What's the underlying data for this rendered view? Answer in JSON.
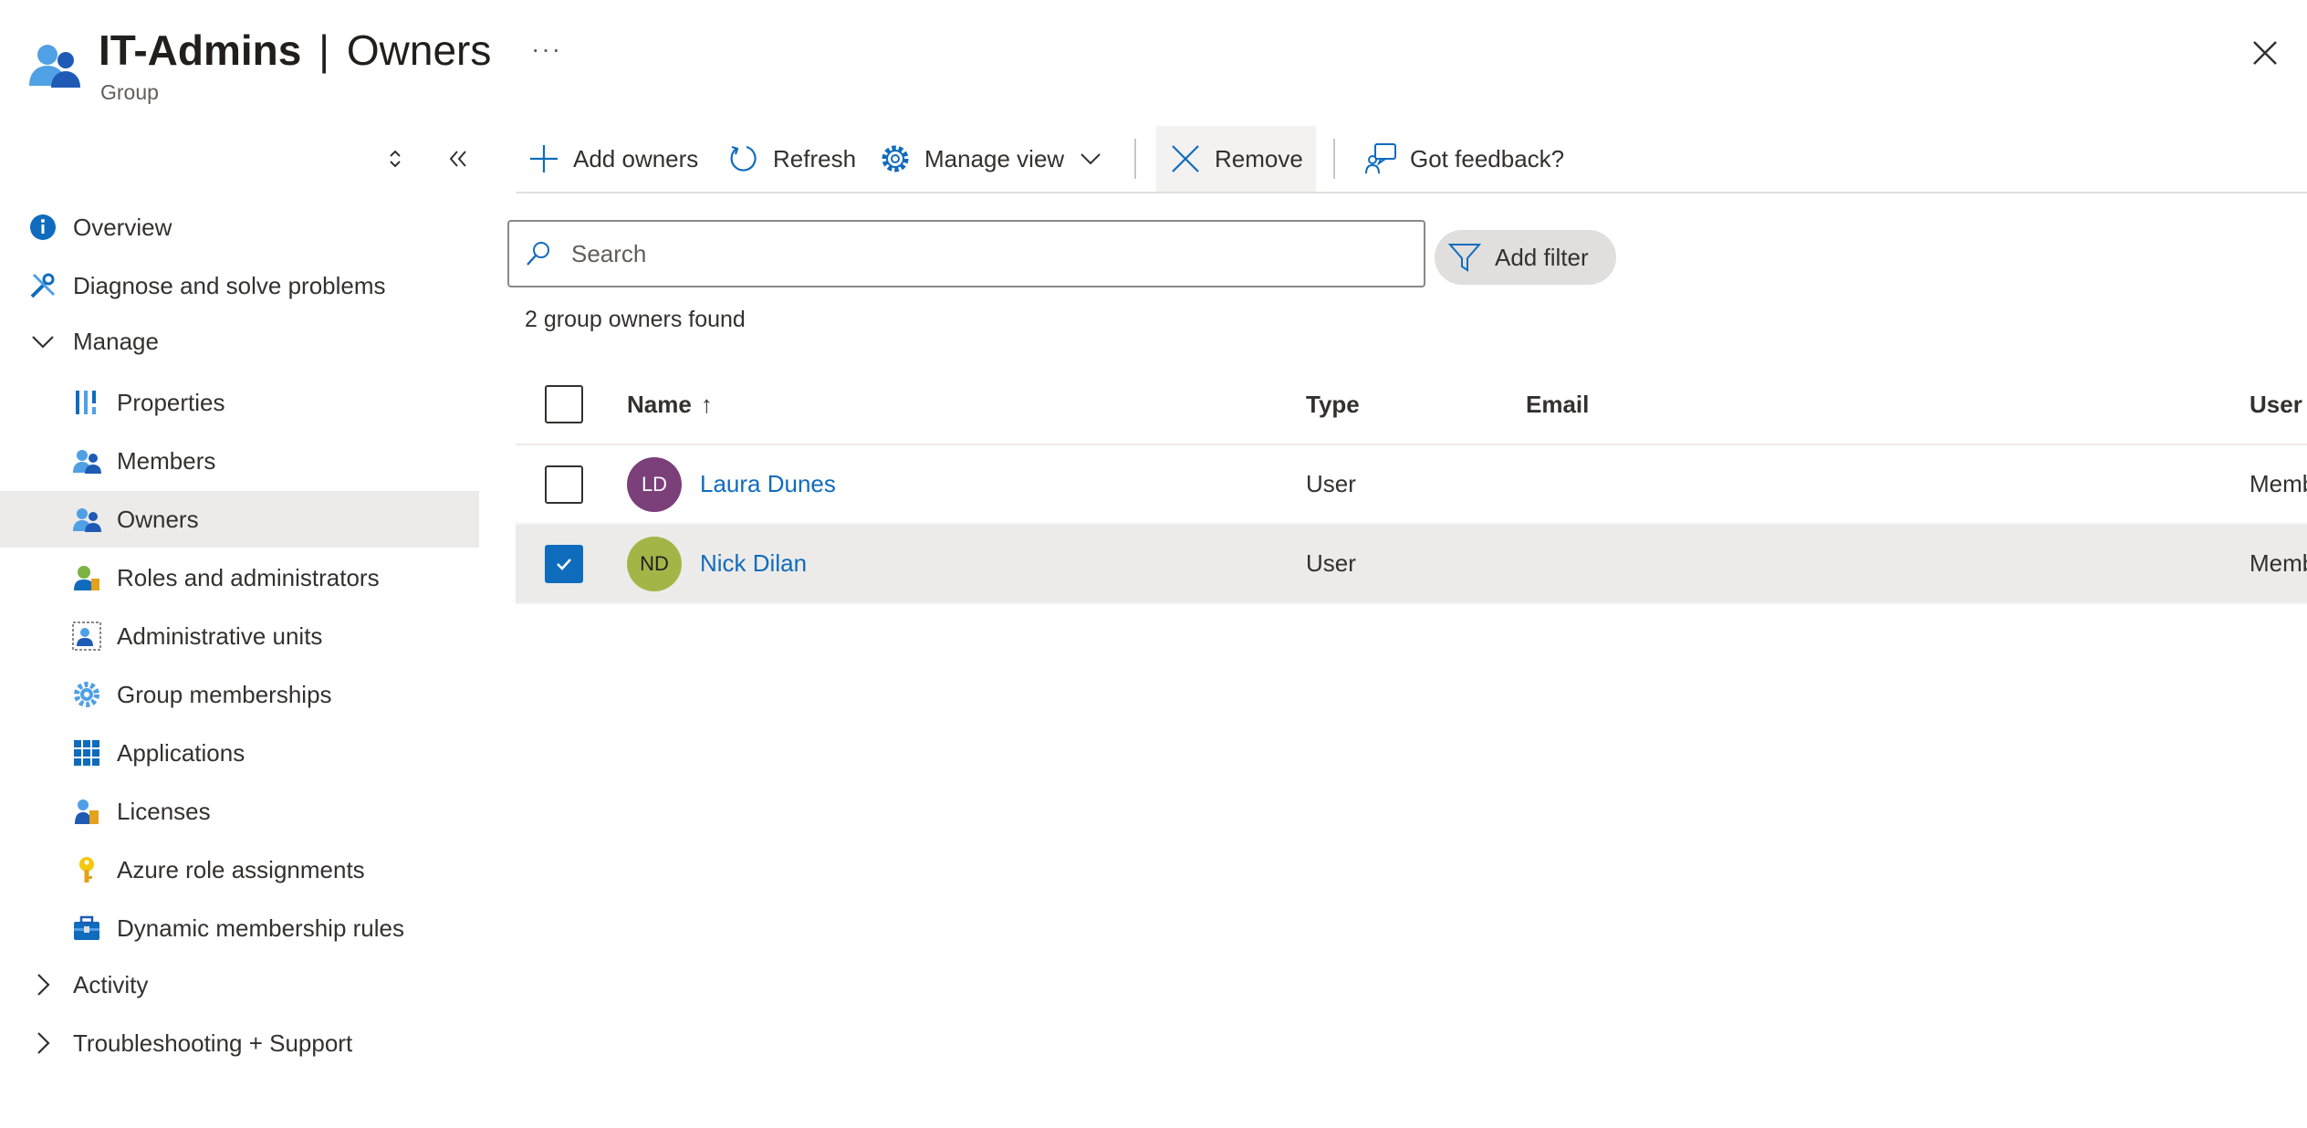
{
  "header": {
    "title_group": "IT-Admins",
    "title_sep": "|",
    "title_page": "Owners",
    "subtitle": "Group",
    "more": "···"
  },
  "sidebar": {
    "items": [
      {
        "label": "Overview",
        "icon": "info-icon"
      },
      {
        "label": "Diagnose and solve problems",
        "icon": "wrench-icon"
      },
      {
        "label": "Manage",
        "icon": "chevron-down-icon"
      },
      {
        "label": "Properties",
        "icon": "properties-icon"
      },
      {
        "label": "Members",
        "icon": "members-icon"
      },
      {
        "label": "Owners",
        "icon": "owners-icon"
      },
      {
        "label": "Roles and administrators",
        "icon": "roles-icon"
      },
      {
        "label": "Administrative units",
        "icon": "admin-units-icon"
      },
      {
        "label": "Group memberships",
        "icon": "gear-icon"
      },
      {
        "label": "Applications",
        "icon": "grid-icon"
      },
      {
        "label": "Licenses",
        "icon": "license-icon"
      },
      {
        "label": "Azure role assignments",
        "icon": "key-icon"
      },
      {
        "label": "Dynamic membership rules",
        "icon": "toolbox-icon"
      },
      {
        "label": "Activity",
        "icon": "chevron-right-icon"
      },
      {
        "label": "Troubleshooting + Support",
        "icon": "chevron-right-icon"
      }
    ]
  },
  "toolbar": {
    "add_owners": "Add owners",
    "refresh": "Refresh",
    "manage_view": "Manage view",
    "remove": "Remove",
    "feedback": "Got feedback?"
  },
  "search": {
    "placeholder": "Search"
  },
  "filter": {
    "label": "Add filter"
  },
  "results": {
    "count_text": "2 group owners found"
  },
  "table": {
    "columns": {
      "name": "Name",
      "sort": "↑",
      "type": "Type",
      "email": "Email",
      "user_type": "User type"
    },
    "rows": [
      {
        "initials": "LD",
        "name": "Laura Dunes",
        "type": "User",
        "email": "",
        "user_type": "Member",
        "checked": false,
        "avatar_color": "#7b3f7a"
      },
      {
        "initials": "ND",
        "name": "Nick Dilan",
        "type": "User",
        "email": "",
        "user_type": "Member",
        "checked": true,
        "avatar_color": "#a4b548"
      }
    ]
  },
  "colors": {
    "accent": "#0f6cbd",
    "selected_bg": "#edebe9"
  }
}
